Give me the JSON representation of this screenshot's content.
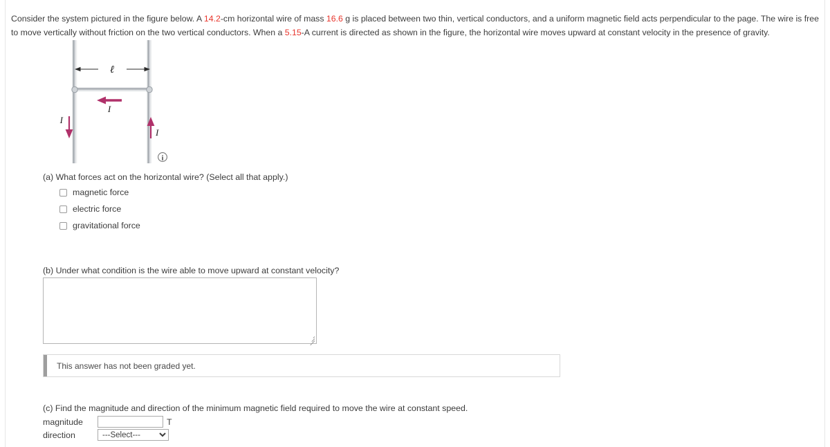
{
  "problem": {
    "segments": [
      {
        "text": "Consider the system pictured in the figure below. A ",
        "highlight": false
      },
      {
        "text": "14.2",
        "highlight": true
      },
      {
        "text": "-cm horizontal wire of mass ",
        "highlight": false
      },
      {
        "text": "16.6",
        "highlight": true
      },
      {
        "text": " g is placed between two thin, vertical conductors, and a uniform magnetic field acts perpendicular to the page. The wire is free to move vertically without friction on the two vertical conductors. When a ",
        "highlight": false
      },
      {
        "text": "5.15",
        "highlight": true
      },
      {
        "text": "-A current is directed as shown in the figure, the horizontal wire moves upward at constant velocity in the presence of gravity.",
        "highlight": false
      }
    ],
    "values": {
      "wire_length_cm": "14.2",
      "wire_mass_g": "16.6",
      "current_A": "5.15"
    }
  },
  "figure": {
    "length_label": "ℓ",
    "current_label_top": "I",
    "current_label_left": "I",
    "current_label_right": "I",
    "info_icon_label": "i",
    "arrow_color": "#b0316a",
    "conductor_color": "#b9bdc2"
  },
  "part_a": {
    "prompt": "(a) What forces act on the horizontal wire? (Select all that apply.)",
    "choices": [
      {
        "label": "magnetic force",
        "checked": false
      },
      {
        "label": "electric force",
        "checked": false
      },
      {
        "label": "gravitational force",
        "checked": false
      }
    ]
  },
  "part_b": {
    "prompt": "(b) Under what condition is the wire able to move upward at constant velocity?",
    "answer_value": "",
    "answer_placeholder": "",
    "notice": "This answer has not been graded yet."
  },
  "part_c": {
    "prompt": "(c) Find the magnitude and direction of the minimum magnetic field required to move the wire at constant speed.",
    "magnitude_label": "magnitude",
    "magnitude_value": "",
    "magnitude_unit": "T",
    "direction_label": "direction",
    "direction_selected": "---Select---",
    "direction_options": [
      "---Select---"
    ]
  }
}
